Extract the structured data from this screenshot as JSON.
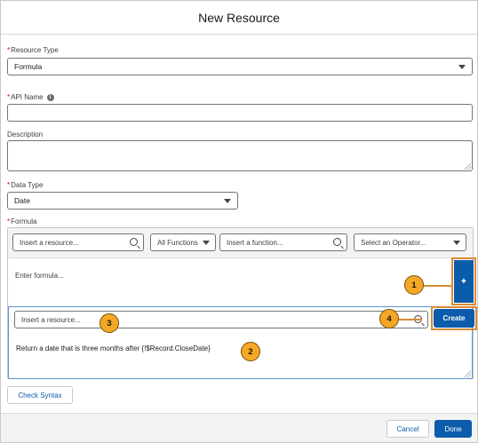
{
  "modal": {
    "title": "New Resource"
  },
  "resource_type": {
    "label": "Resource Type",
    "required_mark": "*",
    "value": "Formula"
  },
  "api_name": {
    "label": "API Name",
    "required_mark": "*",
    "value": "",
    "info_icon": "info-icon"
  },
  "description": {
    "label": "Description",
    "value": ""
  },
  "data_type": {
    "label": "Data Type",
    "required_mark": "*",
    "value": "Date"
  },
  "formula": {
    "label": "Formula",
    "required_mark": "*",
    "toolbar": {
      "resource_placeholder": "Insert a resource...",
      "functions_filter": "All Functions",
      "function_placeholder": "Insert a function...",
      "operator_placeholder": "Select an Operator..."
    },
    "editor_placeholder": "Enter formula...",
    "ai": {
      "resource_placeholder": "Insert a resource...",
      "create_label": "Create",
      "prompt_text": "Return a date that is three months after {!$Record.CloseDate}",
      "sparkle_icon": "sparkle-icon"
    }
  },
  "callouts": [
    "1",
    "2",
    "3",
    "4"
  ],
  "buttons": {
    "check_syntax": "Check Syntax",
    "cancel": "Cancel",
    "done": "Done"
  },
  "colors": {
    "brand": "#0b5cab",
    "callout": "#f4a825",
    "highlight_border": "#d98b36",
    "required": "#ba0517"
  }
}
